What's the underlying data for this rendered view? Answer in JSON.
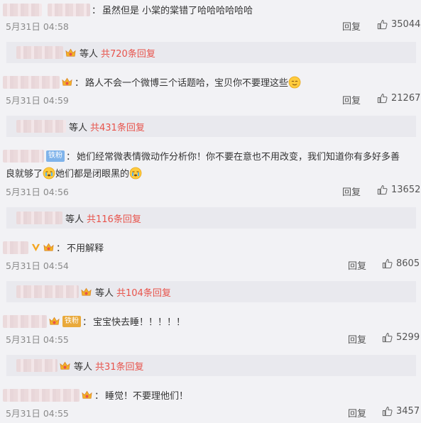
{
  "colors": {
    "accent": "#e8534b",
    "time": "#8a8a8a",
    "background": "#f2f2f5",
    "subbox": "#e9e9ee"
  },
  "reply_label": "回复",
  "etc_label": "等人",
  "comments": [
    {
      "text": "虽然但是 小棠的棠错了哈哈哈哈哈哈",
      "time": "5月31日 04:58",
      "likes": "35044",
      "replies": "共720条回复",
      "badge": "none"
    },
    {
      "text": "路人不会一个微博三个话题哈，宝贝你不要理这些",
      "time": "5月31日 04:59",
      "likes": "21267",
      "replies": "共431条回复",
      "badge": "crown"
    },
    {
      "text_line1": "她们经常微表情微动作分析你！你不要在意也不用改变，我们知道你有多好多善",
      "text_line2a": "良就够了",
      "text_line2b": "她们都是闭眼黑的",
      "fan_badge": "铁粉",
      "time": "5月31日 04:56",
      "likes": "13652",
      "replies": "共116条回复"
    },
    {
      "text": "不用解释",
      "time": "5月31日 04:54",
      "likes": "8605",
      "replies": "共104条回复"
    },
    {
      "text": "宝宝快去睡！！！！！",
      "fan_badge": "铁粉",
      "time": "5月31日 04:55",
      "likes": "5299",
      "replies": "共31条回复"
    },
    {
      "text": "睡觉！不要理他们！",
      "time": "5月31日 04:55",
      "likes": "3457"
    }
  ]
}
